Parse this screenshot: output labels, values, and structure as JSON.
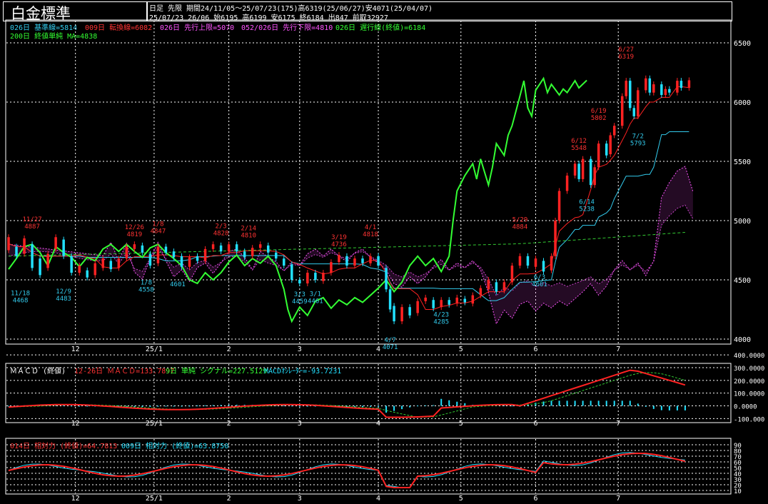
{
  "header": {
    "title": "白金標準",
    "info_line1": "日足 先限 期間24/11/05～25/07/23(175)高6319(25/06/27)安4071(25/04/07)",
    "info_line2": "25/07/23 26/06 始6195 高6199 安6175 終6184 出847 前取32927"
  },
  "colors": {
    "up_candle": "#ff2222",
    "down_candle": "#22e0ff",
    "kijun": "#33ccee",
    "tenkan": "#ff2222",
    "span_a": "#ff55ff",
    "span_b": "#cc44cc",
    "chikou": "#33ff33",
    "ma200": "#33cc33",
    "macd_line": "#ff2222",
    "signal_line": "#33cc33",
    "histogram": "#22e0ff",
    "rsi14": "#ff2222",
    "rsi9": "#22e0ff"
  },
  "legends": {
    "ichimoku": [
      {
        "text": "026日 基準線=5814",
        "color": "#33ccee"
      },
      {
        "text": "009日 転換線=6082",
        "color": "#ff3333"
      },
      {
        "text": "026日 先行上限=5070",
        "color": "#ff55ff"
      },
      {
        "text": "052/026日 先行下限=4810",
        "color": "#ff55ff"
      },
      {
        "text": "026日 遅行線(終値)=6184",
        "color": "#33ff33"
      }
    ],
    "ma": {
      "text": "200日 終値単純 MA=4838",
      "color": "#33ff33"
    },
    "macd_title": "ＭＡＣＤ (終値)",
    "macd": [
      {
        "text": "12-26日 ＭＡＣＤ=133.7897",
        "color": "#ff3333"
      },
      {
        "text": "9日 単純 シグナル=227.5129",
        "color": "#33ff33"
      },
      {
        "text": "MACDｵｼﾚｰﾀｰ=-93.7231",
        "color": "#22e0ff"
      }
    ],
    "rsi": [
      {
        "text": "014日 相対力 (終値)=64.7813",
        "color": "#ff3333"
      },
      {
        "text": "009日 相対力 (終値)=63.8750",
        "color": "#22e0ff"
      }
    ]
  },
  "x_axis": {
    "labels": [
      {
        "text": "12",
        "day": 17
      },
      {
        "text": "25/1",
        "day": 37
      },
      {
        "text": "2",
        "day": 56
      },
      {
        "text": "3",
        "day": 74
      },
      {
        "text": "4",
        "day": 94
      },
      {
        "text": "5",
        "day": 115
      },
      {
        "text": "6",
        "day": 134
      },
      {
        "text": "7",
        "day": 155
      }
    ]
  },
  "chart_data": [
    {
      "type": "candlestick",
      "title": "白金標準",
      "ylim": [
        4000,
        6600
      ],
      "y_ticks": [
        4000,
        4500,
        5000,
        5500,
        6000,
        6500
      ],
      "series": [
        {
          "name": "026日 基準線",
          "last": 5814
        },
        {
          "name": "009日 転換線",
          "last": 6082
        },
        {
          "name": "026日 先行上限",
          "last": 5070
        },
        {
          "name": "052/026日 先行下限",
          "last": 4810
        },
        {
          "name": "026日 遅行線(終値)",
          "last": 6184
        },
        {
          "name": "200日 終値単純 MA",
          "last": 4838
        }
      ],
      "candles": [
        {
          "day": 0,
          "o": 4750,
          "c": 4860
        },
        {
          "day": 2,
          "o": 4780,
          "c": 4700
        },
        {
          "day": 4,
          "o": 4720,
          "c": 4850
        },
        {
          "day": 6,
          "o": 4800,
          "c": 4600
        },
        {
          "day": 8,
          "o": 4680,
          "c": 4540
        },
        {
          "day": 10,
          "o": 4600,
          "c": 4720
        },
        {
          "day": 12,
          "o": 4760,
          "c": 4860
        },
        {
          "day": 14,
          "o": 4840,
          "c": 4700
        },
        {
          "day": 16,
          "o": 4700,
          "c": 4560
        },
        {
          "day": 18,
          "o": 4560,
          "c": 4620
        },
        {
          "day": 20,
          "o": 4580,
          "c": 4520
        },
        {
          "day": 22,
          "o": 4540,
          "c": 4640
        },
        {
          "day": 24,
          "o": 4600,
          "c": 4680
        },
        {
          "day": 26,
          "o": 4660,
          "c": 4590
        },
        {
          "day": 28,
          "o": 4600,
          "c": 4680
        },
        {
          "day": 30,
          "o": 4680,
          "c": 4780
        },
        {
          "day": 32,
          "o": 4760,
          "c": 4800
        },
        {
          "day": 34,
          "o": 4790,
          "c": 4730
        },
        {
          "day": 36,
          "o": 4720,
          "c": 4620
        },
        {
          "day": 38,
          "o": 4640,
          "c": 4780
        },
        {
          "day": 40,
          "o": 4780,
          "c": 4730
        },
        {
          "day": 42,
          "o": 4740,
          "c": 4690
        },
        {
          "day": 44,
          "o": 4700,
          "c": 4610
        },
        {
          "day": 46,
          "o": 4610,
          "c": 4690
        },
        {
          "day": 48,
          "o": 4700,
          "c": 4660
        },
        {
          "day": 50,
          "o": 4660,
          "c": 4760
        },
        {
          "day": 52,
          "o": 4760,
          "c": 4800
        },
        {
          "day": 54,
          "o": 4790,
          "c": 4740
        },
        {
          "day": 56,
          "o": 4740,
          "c": 4800
        },
        {
          "day": 58,
          "o": 4800,
          "c": 4740
        },
        {
          "day": 60,
          "o": 4740,
          "c": 4690
        },
        {
          "day": 62,
          "o": 4700,
          "c": 4770
        },
        {
          "day": 64,
          "o": 4770,
          "c": 4800
        },
        {
          "day": 66,
          "o": 4790,
          "c": 4730
        },
        {
          "day": 68,
          "o": 4730,
          "c": 4680
        },
        {
          "day": 70,
          "o": 4680,
          "c": 4620
        },
        {
          "day": 72,
          "o": 4630,
          "c": 4500
        },
        {
          "day": 74,
          "o": 4500,
          "c": 4470
        },
        {
          "day": 76,
          "o": 4470,
          "c": 4560
        },
        {
          "day": 78,
          "o": 4560,
          "c": 4500
        },
        {
          "day": 80,
          "o": 4490,
          "c": 4560
        },
        {
          "day": 82,
          "o": 4560,
          "c": 4650
        },
        {
          "day": 84,
          "o": 4650,
          "c": 4710
        },
        {
          "day": 86,
          "o": 4700,
          "c": 4620
        },
        {
          "day": 88,
          "o": 4620,
          "c": 4680
        },
        {
          "day": 90,
          "o": 4680,
          "c": 4640
        },
        {
          "day": 92,
          "o": 4640,
          "c": 4700
        },
        {
          "day": 94,
          "o": 4700,
          "c": 4620
        },
        {
          "day": 96,
          "o": 4600,
          "c": 4420
        },
        {
          "day": 97,
          "o": 4420,
          "c": 4250
        },
        {
          "day": 98,
          "o": 4280,
          "c": 4150
        },
        {
          "day": 100,
          "o": 4150,
          "c": 4270
        },
        {
          "day": 102,
          "o": 4270,
          "c": 4200
        },
        {
          "day": 104,
          "o": 4220,
          "c": 4320
        },
        {
          "day": 106,
          "o": 4320,
          "c": 4350
        },
        {
          "day": 108,
          "o": 4330,
          "c": 4260
        },
        {
          "day": 110,
          "o": 4270,
          "c": 4330
        },
        {
          "day": 112,
          "o": 4330,
          "c": 4290
        },
        {
          "day": 114,
          "o": 4300,
          "c": 4350
        },
        {
          "day": 116,
          "o": 4340,
          "c": 4310
        },
        {
          "day": 118,
          "o": 4300,
          "c": 4370
        },
        {
          "day": 120,
          "o": 4370,
          "c": 4430
        },
        {
          "day": 122,
          "o": 4420,
          "c": 4500
        },
        {
          "day": 124,
          "o": 4480,
          "c": 4400
        },
        {
          "day": 126,
          "o": 4410,
          "c": 4480
        },
        {
          "day": 128,
          "o": 4480,
          "c": 4620
        },
        {
          "day": 130,
          "o": 4620,
          "c": 4700
        },
        {
          "day": 132,
          "o": 4700,
          "c": 4620
        },
        {
          "day": 134,
          "o": 4610,
          "c": 4680
        },
        {
          "day": 136,
          "o": 4660,
          "c": 4570
        },
        {
          "day": 138,
          "o": 4580,
          "c": 4700
        },
        {
          "day": 139,
          "o": 4700,
          "c": 5000
        },
        {
          "day": 140,
          "o": 5000,
          "c": 5250
        },
        {
          "day": 142,
          "o": 5250,
          "c": 5380
        },
        {
          "day": 144,
          "o": 5380,
          "c": 5480
        },
        {
          "day": 145,
          "o": 5480,
          "c": 5350
        },
        {
          "day": 146,
          "o": 5350,
          "c": 5520
        },
        {
          "day": 148,
          "o": 5520,
          "c": 5300
        },
        {
          "day": 149,
          "o": 5300,
          "c": 5450
        },
        {
          "day": 150,
          "o": 5450,
          "c": 5650
        },
        {
          "day": 152,
          "o": 5650,
          "c": 5550
        },
        {
          "day": 153,
          "o": 5560,
          "c": 5720
        },
        {
          "day": 154,
          "o": 5720,
          "c": 5800
        },
        {
          "day": 156,
          "o": 5800,
          "c": 6050
        },
        {
          "day": 157,
          "o": 6050,
          "c": 6180
        },
        {
          "day": 158,
          "o": 6180,
          "c": 5950
        },
        {
          "day": 159,
          "o": 5950,
          "c": 5880
        },
        {
          "day": 160,
          "o": 5880,
          "c": 6100
        },
        {
          "day": 162,
          "o": 6100,
          "c": 6200
        },
        {
          "day": 163,
          "o": 6200,
          "c": 6080
        },
        {
          "day": 164,
          "o": 6080,
          "c": 6150
        },
        {
          "day": 166,
          "o": 6150,
          "c": 6060
        },
        {
          "day": 167,
          "o": 6060,
          "c": 6110
        },
        {
          "day": 168,
          "o": 6110,
          "c": 6080
        },
        {
          "day": 170,
          "o": 6080,
          "c": 6180
        },
        {
          "day": 171,
          "o": 6180,
          "c": 6120
        },
        {
          "day": 173,
          "o": 6120,
          "c": 6184
        }
      ],
      "annotations": [
        {
          "date": "11/27",
          "value": "4887",
          "day": 6,
          "kind": "high"
        },
        {
          "date": "11/18",
          "value": "4468",
          "day": 3,
          "kind": "low"
        },
        {
          "date": "12/9",
          "value": "4483",
          "day": 14,
          "kind": "low"
        },
        {
          "date": "12/26",
          "value": "4819",
          "day": 32,
          "kind": "high"
        },
        {
          "date": "1/8",
          "value": "4847",
          "day": 38,
          "kind": "high"
        },
        {
          "date": "1/8",
          "value": "4558",
          "day": 35,
          "kind": "low"
        },
        {
          "date": "",
          "value": "4601",
          "day": 43,
          "kind": "low"
        },
        {
          "date": "2/3",
          "value": "4828",
          "day": 54,
          "kind": "high"
        },
        {
          "date": "2/14",
          "value": "4810",
          "day": 61,
          "kind": "high"
        },
        {
          "date": "3/3",
          "value": "4459",
          "day": 74,
          "kind": "low"
        },
        {
          "date": "3/1",
          "value": "4461",
          "day": 78,
          "kind": "low"
        },
        {
          "date": "3/19",
          "value": "4736",
          "day": 84,
          "kind": "high"
        },
        {
          "date": "4/1",
          "value": "4818",
          "day": 92,
          "kind": "high"
        },
        {
          "date": "4/7",
          "value": "4071",
          "day": 97,
          "kind": "low"
        },
        {
          "date": "4/23",
          "value": "4285",
          "day": 110,
          "kind": "low"
        },
        {
          "date": "5/29",
          "value": "4884",
          "day": 130,
          "kind": "high"
        },
        {
          "date": "6/3",
          "value": "4601",
          "day": 135,
          "kind": "low"
        },
        {
          "date": "6/12",
          "value": "5548",
          "day": 145,
          "kind": "high"
        },
        {
          "date": "6/14",
          "value": "5238",
          "day": 147,
          "kind": "low"
        },
        {
          "date": "6/19",
          "value": "5802",
          "day": 150,
          "kind": "high"
        },
        {
          "date": "6/27",
          "value": "6319",
          "day": 157,
          "kind": "high"
        },
        {
          "date": "7/2",
          "value": "5793",
          "day": 160,
          "kind": "low"
        }
      ]
    },
    {
      "type": "line",
      "title": "ＭＡＣＤ (終値)",
      "ylim": [
        -100000,
        400000
      ],
      "y_ticks": [
        -100000,
        0,
        100000,
        200000,
        300000,
        400000
      ],
      "y_tick_labels": [
        "-100.000",
        "0.0000",
        "100.0000",
        "200.0000",
        "300.0000",
        "400.0000"
      ],
      "series": [
        {
          "name": "12-26日 ＭＡＣＤ",
          "last": 133.7897
        },
        {
          "name": "9日 単純 シグナル",
          "last": 227.5129
        },
        {
          "name": "MACDｵｼﾚｰﾀｰ",
          "last": -93.7231
        }
      ]
    },
    {
      "type": "line",
      "title": "相対力",
      "ylim": [
        10,
        90
      ],
      "y_ticks": [
        10,
        20,
        30,
        40,
        50,
        60,
        70,
        80,
        90
      ],
      "series": [
        {
          "name": "014日 相対力 (終値)",
          "last": 64.7813
        },
        {
          "name": "009日 相対力 (終値)",
          "last": 63.875
        }
      ]
    }
  ]
}
